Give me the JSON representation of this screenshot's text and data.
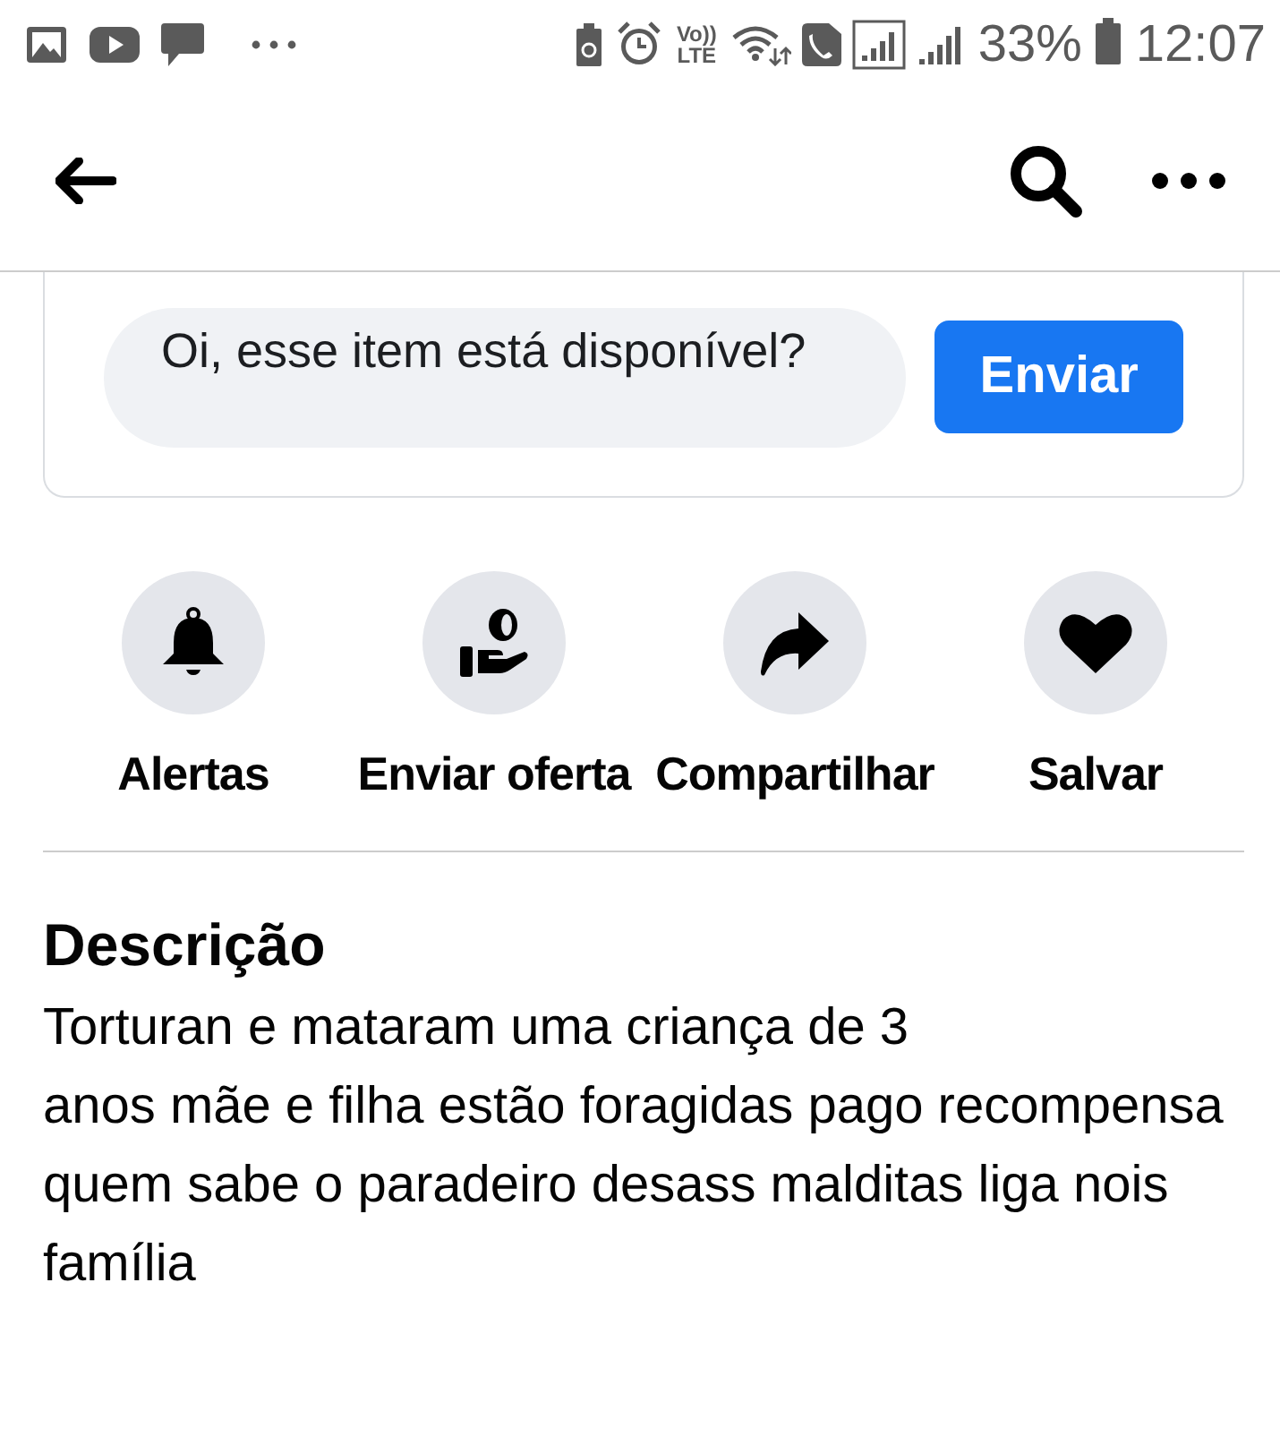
{
  "status_bar": {
    "volte_top": "Vo))",
    "volte_bottom": "LTE",
    "battery_percent": "33%",
    "time": "12:07"
  },
  "message": {
    "value": "Oi, esse item está disponível?",
    "send_button": "Enviar"
  },
  "actions": [
    {
      "kind": "bell",
      "label": "Alertas"
    },
    {
      "kind": "offer",
      "label": "Enviar oferta"
    },
    {
      "kind": "share",
      "label": "Compartilhar"
    },
    {
      "kind": "heart",
      "label": "Salvar"
    }
  ],
  "description": {
    "title": "Descrição",
    "text": "Torturan e mataram uma criança de 3\nanos mãe e filha estão foragidas pago recompensa quem sabe o paradeiro desass malditas liga nois família"
  }
}
